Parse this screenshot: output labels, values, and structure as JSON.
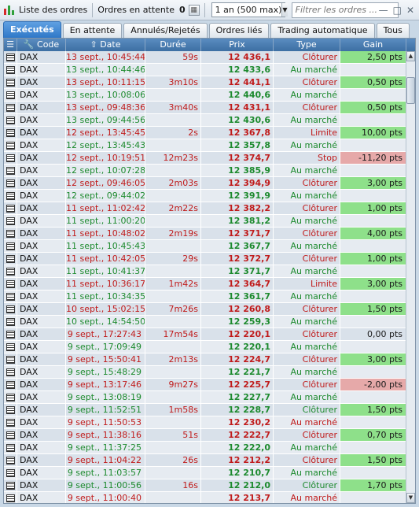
{
  "toolbar": {
    "title": "Liste des ordres",
    "pending_label": "Ordres en attente",
    "pending_count": "0",
    "period": "1 an (500 max)",
    "filter_placeholder": "Filtrer les ordres ..."
  },
  "tabs": [
    "Exécutés",
    "En attente",
    "Annulés/Rejetés",
    "Ordres liés",
    "Trading automatique",
    "Tous"
  ],
  "columns": {
    "code": "Code",
    "date": "Date",
    "duree": "Durée",
    "prix": "Prix",
    "type": "Type",
    "gain": "Gain"
  },
  "rows": [
    {
      "code": "DAX",
      "date": "13 sept., 10:45:44",
      "duree": "59s",
      "prix": "12 436,1",
      "type": "Clôturer",
      "gain": "2,50 pts",
      "side": "red",
      "gclass": "g-pos"
    },
    {
      "code": "DAX",
      "date": "13 sept., 10:44:46",
      "duree": "",
      "prix": "12 433,6",
      "type": "Au marché",
      "gain": "",
      "side": "green",
      "gclass": ""
    },
    {
      "code": "DAX",
      "date": "13 sept., 10:11:15",
      "duree": "3m10s",
      "prix": "12 441,1",
      "type": "Clôturer",
      "gain": "0,50 pts",
      "side": "red",
      "gclass": "g-pos"
    },
    {
      "code": "DAX",
      "date": "13 sept., 10:08:06",
      "duree": "",
      "prix": "12 440,6",
      "type": "Au marché",
      "gain": "",
      "side": "green",
      "gclass": ""
    },
    {
      "code": "DAX",
      "date": "13 sept., 09:48:36",
      "duree": "3m40s",
      "prix": "12 431,1",
      "type": "Clôturer",
      "gain": "0,50 pts",
      "side": "red",
      "gclass": "g-pos"
    },
    {
      "code": "DAX",
      "date": "13 sept., 09:44:56",
      "duree": "",
      "prix": "12 430,6",
      "type": "Au marché",
      "gain": "",
      "side": "green",
      "gclass": ""
    },
    {
      "code": "DAX",
      "date": "12 sept., 13:45:45",
      "duree": "2s",
      "prix": "12 367,8",
      "type": "Limite",
      "gain": "10,00 pts",
      "side": "red",
      "gclass": "g-pos"
    },
    {
      "code": "DAX",
      "date": "12 sept., 13:45:43",
      "duree": "",
      "prix": "12 357,8",
      "type": "Au marché",
      "gain": "",
      "side": "green",
      "gclass": ""
    },
    {
      "code": "DAX",
      "date": "12 sept., 10:19:51",
      "duree": "12m23s",
      "prix": "12 374,7",
      "type": "Stop",
      "gain": "-11,20 pts",
      "side": "red",
      "gclass": "g-neg"
    },
    {
      "code": "DAX",
      "date": "12 sept., 10:07:28",
      "duree": "",
      "prix": "12 385,9",
      "type": "Au marché",
      "gain": "",
      "side": "green",
      "gclass": ""
    },
    {
      "code": "DAX",
      "date": "12 sept., 09:46:05",
      "duree": "2m03s",
      "prix": "12 394,9",
      "type": "Clôturer",
      "gain": "3,00 pts",
      "side": "red",
      "gclass": "g-pos"
    },
    {
      "code": "DAX",
      "date": "12 sept., 09:44:02",
      "duree": "",
      "prix": "12 391,9",
      "type": "Au marché",
      "gain": "",
      "side": "green",
      "gclass": ""
    },
    {
      "code": "DAX",
      "date": "11 sept., 11:02:42",
      "duree": "2m22s",
      "prix": "12 382,2",
      "type": "Clôturer",
      "gain": "1,00 pts",
      "side": "red",
      "gclass": "g-pos"
    },
    {
      "code": "DAX",
      "date": "11 sept., 11:00:20",
      "duree": "",
      "prix": "12 381,2",
      "type": "Au marché",
      "gain": "",
      "side": "green",
      "gclass": ""
    },
    {
      "code": "DAX",
      "date": "11 sept., 10:48:02",
      "duree": "2m19s",
      "prix": "12 371,7",
      "type": "Clôturer",
      "gain": "4,00 pts",
      "side": "red",
      "gclass": "g-pos"
    },
    {
      "code": "DAX",
      "date": "11 sept., 10:45:43",
      "duree": "",
      "prix": "12 367,7",
      "type": "Au marché",
      "gain": "",
      "side": "green",
      "gclass": ""
    },
    {
      "code": "DAX",
      "date": "11 sept., 10:42:05",
      "duree": "29s",
      "prix": "12 372,7",
      "type": "Clôturer",
      "gain": "1,00 pts",
      "side": "red",
      "gclass": "g-pos"
    },
    {
      "code": "DAX",
      "date": "11 sept., 10:41:37",
      "duree": "",
      "prix": "12 371,7",
      "type": "Au marché",
      "gain": "",
      "side": "green",
      "gclass": ""
    },
    {
      "code": "DAX",
      "date": "11 sept., 10:36:17",
      "duree": "1m42s",
      "prix": "12 364,7",
      "type": "Limite",
      "gain": "3,00 pts",
      "side": "red",
      "gclass": "g-pos"
    },
    {
      "code": "DAX",
      "date": "11 sept., 10:34:35",
      "duree": "",
      "prix": "12 361,7",
      "type": "Au marché",
      "gain": "",
      "side": "green",
      "gclass": ""
    },
    {
      "code": "DAX",
      "date": "10 sept., 15:02:15",
      "duree": "7m26s",
      "prix": "12 260,8",
      "type": "Clôturer",
      "gain": "1,50 pts",
      "side": "red",
      "gclass": "g-pos"
    },
    {
      "code": "DAX",
      "date": "10 sept., 14:54:50",
      "duree": "",
      "prix": "12 259,3",
      "type": "Au marché",
      "gain": "",
      "side": "green",
      "gclass": ""
    },
    {
      "code": "DAX",
      "date": "9 sept., 17:27:43",
      "duree": "17m54s",
      "prix": "12 220,1",
      "type": "Clôturer",
      "gain": "0,00 pts",
      "side": "red",
      "gclass": ""
    },
    {
      "code": "DAX",
      "date": "9 sept., 17:09:49",
      "duree": "",
      "prix": "12 220,1",
      "type": "Au marché",
      "gain": "",
      "side": "green",
      "gclass": ""
    },
    {
      "code": "DAX",
      "date": "9 sept., 15:50:41",
      "duree": "2m13s",
      "prix": "12 224,7",
      "type": "Clôturer",
      "gain": "3,00 pts",
      "side": "red",
      "gclass": "g-pos"
    },
    {
      "code": "DAX",
      "date": "9 sept., 15:48:29",
      "duree": "",
      "prix": "12 221,7",
      "type": "Au marché",
      "gain": "",
      "side": "green",
      "gclass": ""
    },
    {
      "code": "DAX",
      "date": "9 sept., 13:17:46",
      "duree": "9m27s",
      "prix": "12 225,7",
      "type": "Clôturer",
      "gain": "-2,00 pts",
      "side": "red",
      "gclass": "g-neg"
    },
    {
      "code": "DAX",
      "date": "9 sept., 13:08:19",
      "duree": "",
      "prix": "12 227,7",
      "type": "Au marché",
      "gain": "",
      "side": "green",
      "gclass": ""
    },
    {
      "code": "DAX",
      "date": "9 sept., 11:52:51",
      "duree": "1m58s",
      "prix": "12 228,7",
      "type": "Clôturer",
      "gain": "1,50 pts",
      "side": "green",
      "gclass": "g-pos"
    },
    {
      "code": "DAX",
      "date": "9 sept., 11:50:53",
      "duree": "",
      "prix": "12 230,2",
      "type": "Au marché",
      "gain": "",
      "side": "red",
      "gclass": ""
    },
    {
      "code": "DAX",
      "date": "9 sept., 11:38:16",
      "duree": "51s",
      "prix": "12 222,7",
      "type": "Clôturer",
      "gain": "0,70 pts",
      "side": "red",
      "gclass": "g-pos"
    },
    {
      "code": "DAX",
      "date": "9 sept., 11:37:25",
      "duree": "",
      "prix": "12 222,0",
      "type": "Au marché",
      "gain": "",
      "side": "green",
      "gclass": ""
    },
    {
      "code": "DAX",
      "date": "9 sept., 11:04:22",
      "duree": "26s",
      "prix": "12 212,2",
      "type": "Clôturer",
      "gain": "1,50 pts",
      "side": "red",
      "gclass": "g-pos"
    },
    {
      "code": "DAX",
      "date": "9 sept., 11:03:57",
      "duree": "",
      "prix": "12 210,7",
      "type": "Au marché",
      "gain": "",
      "side": "green",
      "gclass": ""
    },
    {
      "code": "DAX",
      "date": "9 sept., 11:00:56",
      "duree": "16s",
      "prix": "12 212,0",
      "type": "Clôturer",
      "gain": "1,70 pts",
      "side": "green",
      "gclass": "g-pos"
    },
    {
      "code": "DAX",
      "date": "9 sept., 11:00:40",
      "duree": "",
      "prix": "12 213,7",
      "type": "Au marché",
      "gain": "",
      "side": "red",
      "gclass": ""
    }
  ]
}
